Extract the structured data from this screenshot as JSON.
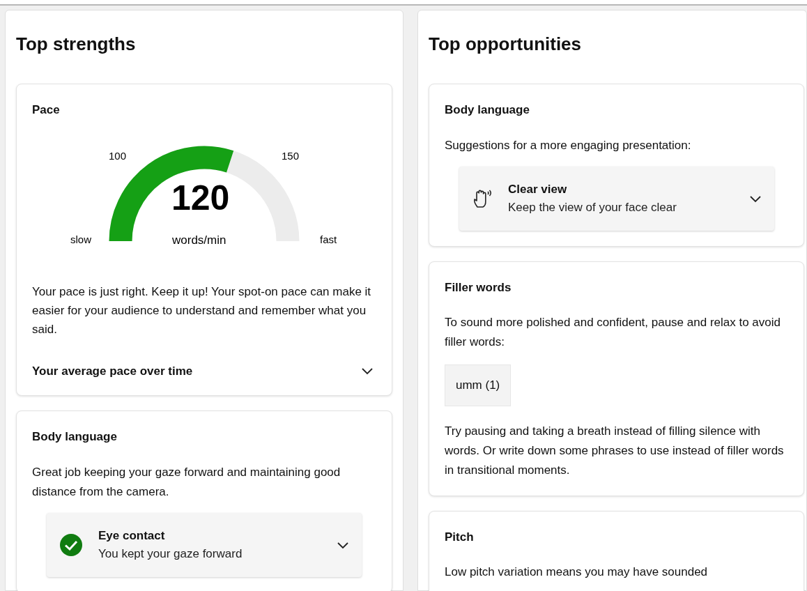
{
  "columns": [
    {
      "title": "Top strengths",
      "cards": [
        {
          "kind": "pace",
          "title": "Pace",
          "gauge": {
            "min_label": "100",
            "max_label": "150",
            "slow_label": "slow",
            "fast_label": "fast",
            "value": "120",
            "unit": "words/min"
          },
          "text": "Your pace is just right. Keep it up! Your spot-on pace can make it easier for your audience to understand and remember what you said.",
          "expander": {
            "label": "Your average pace over time",
            "expanded": false
          }
        },
        {
          "kind": "tips",
          "title": "Body language",
          "text": "Great job keeping your gaze forward and maintaining good distance from the camera.",
          "tip": {
            "kind": "success",
            "title": "Eye contact",
            "subtitle": "You kept your gaze forward",
            "expanded": false
          }
        }
      ]
    },
    {
      "title": "Top opportunities",
      "cards": [
        {
          "kind": "tips",
          "title": "Body language",
          "text": "Suggestions for a more engaging presentation:",
          "tip": {
            "kind": "suggestion",
            "title": "Clear view",
            "subtitle": "Keep the view of your face clear",
            "expanded": false
          }
        },
        {
          "kind": "filler",
          "title": "Filler words",
          "text": "To sound more polished and confident, pause and relax to avoid filler words:",
          "chips": [
            "umm (1)"
          ],
          "note": "Try pausing and taking a breath instead of filling silence with words. Or write down some phrases to use instead of filler words in transitional moments."
        },
        {
          "kind": "text",
          "title": "Pitch",
          "text": "Low pitch variation means you may have sounded"
        }
      ]
    }
  ]
}
